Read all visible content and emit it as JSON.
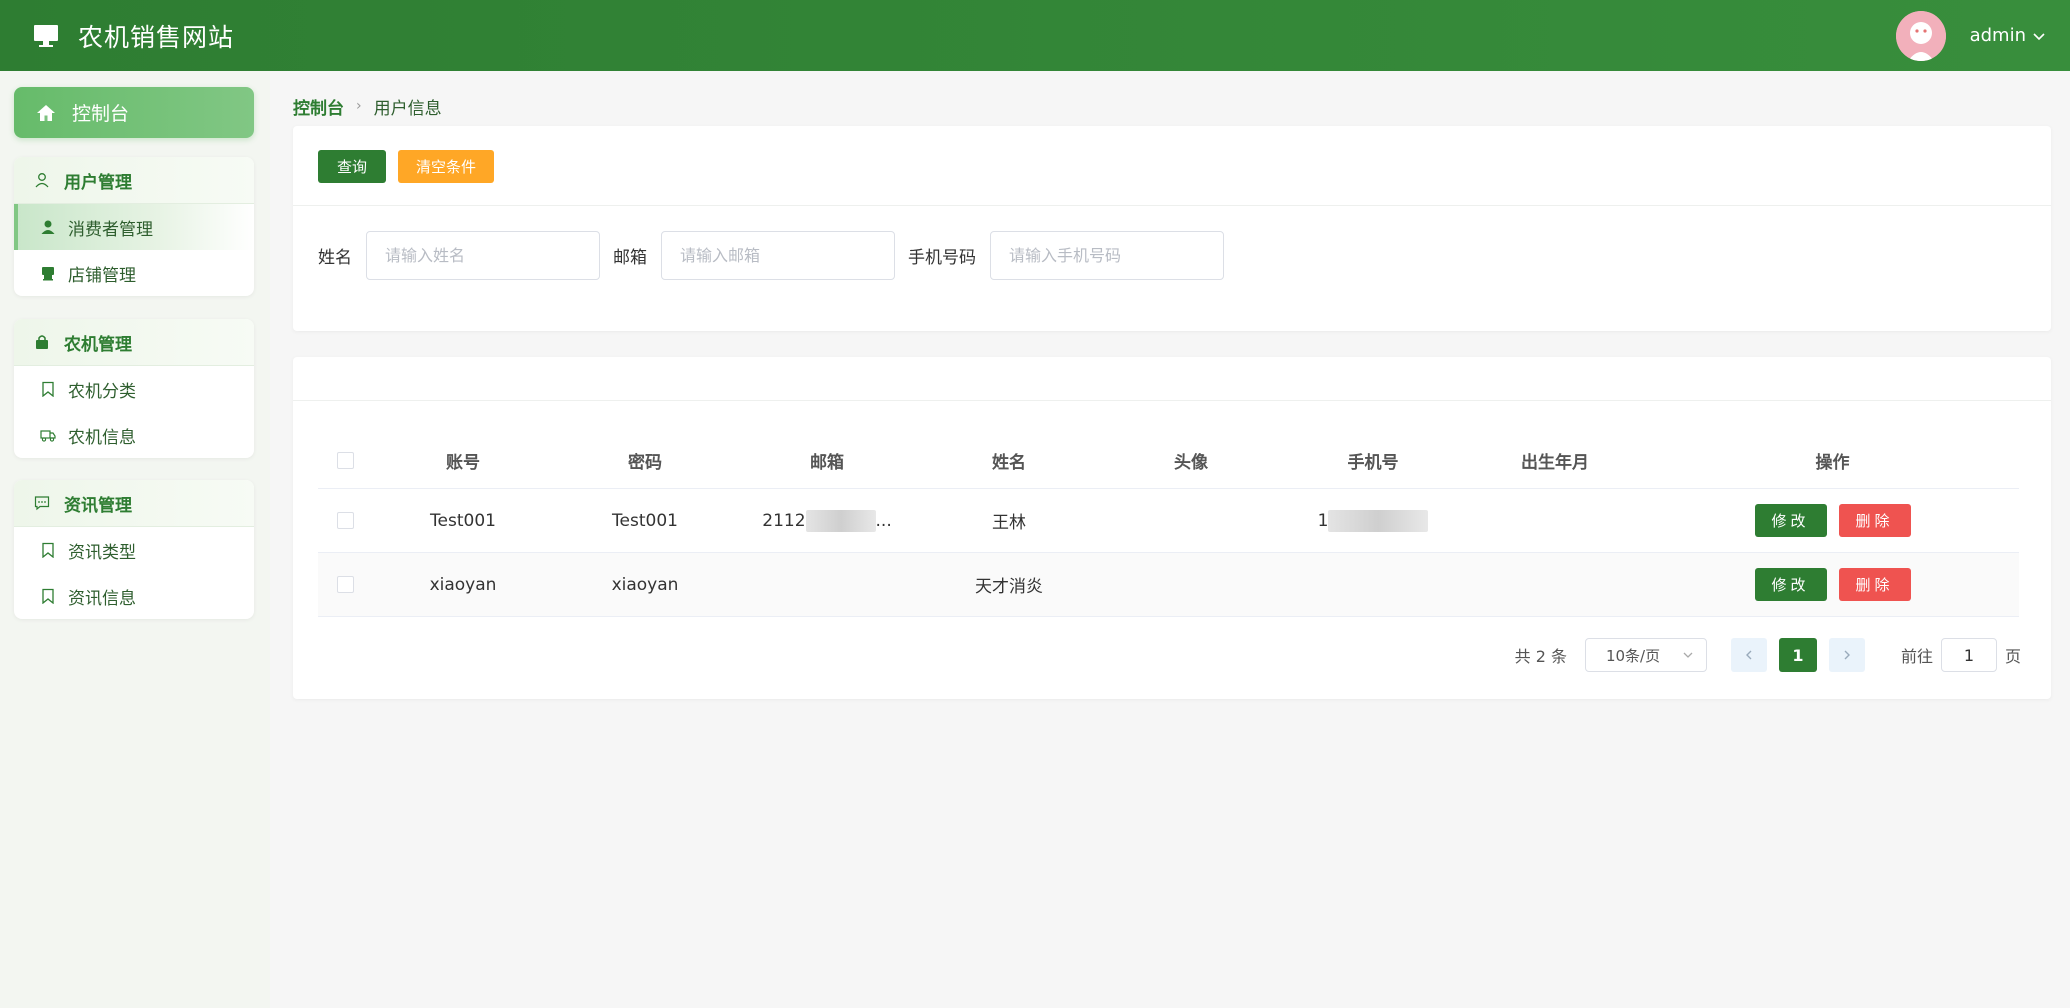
{
  "header": {
    "title": "农机销售网站",
    "user": "admin",
    "brand_icon": "monitor-icon",
    "accent": "#2e7d32"
  },
  "sidebar": {
    "dashboard": "控制台",
    "groups": [
      {
        "title": "用户管理",
        "icon": "user-outline-icon",
        "items": [
          {
            "label": "消费者管理",
            "icon": "person-icon",
            "active": true
          },
          {
            "label": "店铺管理",
            "icon": "store-icon",
            "active": false
          }
        ]
      },
      {
        "title": "农机管理",
        "icon": "bag-icon",
        "items": [
          {
            "label": "农机分类",
            "icon": "bookmark-icon",
            "active": false
          },
          {
            "label": "农机信息",
            "icon": "truck-icon",
            "active": false
          }
        ]
      },
      {
        "title": "资讯管理",
        "icon": "chat-icon",
        "items": [
          {
            "label": "资讯类型",
            "icon": "bookmark-icon",
            "active": false
          },
          {
            "label": "资讯信息",
            "icon": "bookmark-icon",
            "active": false
          }
        ]
      }
    ]
  },
  "breadcrumb": {
    "root": "控制台",
    "current": "用户信息"
  },
  "search": {
    "query_label": "查询",
    "clear_label": "清空条件",
    "fields": [
      {
        "label": "姓名",
        "placeholder": "请输入姓名",
        "value": ""
      },
      {
        "label": "邮箱",
        "placeholder": "请输入邮箱",
        "value": ""
      },
      {
        "label": "手机号码",
        "placeholder": "请输入手机号码",
        "value": ""
      }
    ]
  },
  "table": {
    "columns": [
      "账号",
      "密码",
      "邮箱",
      "姓名",
      "头像",
      "手机号",
      "出生年月",
      "操作"
    ],
    "rows": [
      {
        "account": "Test001",
        "password": "Test001",
        "email": "2112",
        "email_suffix": "...",
        "name": "王林",
        "avatar": "",
        "phone": "1",
        "birth": ""
      },
      {
        "account": "xiaoyan",
        "password": "xiaoyan",
        "email": "",
        "email_suffix": "",
        "name": "天才消炎",
        "avatar": "",
        "phone": "",
        "birth": ""
      }
    ],
    "edit_label": "修改",
    "delete_label": "删除"
  },
  "pagination": {
    "total": "共 2 条",
    "page_size": "10条/页",
    "current": "1",
    "goto_label": "前往",
    "goto_value": "1",
    "unit": "页"
  }
}
